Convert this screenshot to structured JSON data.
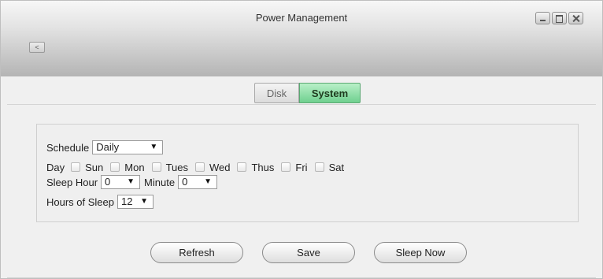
{
  "window": {
    "title": "Power Management",
    "back_label": "<",
    "controls": [
      "minimize-icon",
      "maximize-icon",
      "close-icon"
    ]
  },
  "tabs": [
    {
      "label": "Disk",
      "active": false
    },
    {
      "label": "System",
      "active": true
    }
  ],
  "schedule": {
    "label": "Schedule",
    "value": "Daily"
  },
  "days": {
    "label": "Day",
    "items": [
      {
        "label": "Sun",
        "checked": false
      },
      {
        "label": "Mon",
        "checked": false
      },
      {
        "label": "Tues",
        "checked": false
      },
      {
        "label": "Wed",
        "checked": false
      },
      {
        "label": "Thus",
        "checked": false
      },
      {
        "label": "Fri",
        "checked": false
      },
      {
        "label": "Sat",
        "checked": false
      }
    ]
  },
  "sleep_hour": {
    "label": "Sleep Hour",
    "value": "0"
  },
  "minute": {
    "label": "Minute",
    "value": "0"
  },
  "hours_of_sleep": {
    "label": "Hours of Sleep",
    "value": "12"
  },
  "buttons": {
    "refresh": "Refresh",
    "save": "Save",
    "sleep_now": "Sleep Now"
  },
  "colors": {
    "active_tab": "#6fd08f",
    "titlebar": "#b4b4b4"
  }
}
